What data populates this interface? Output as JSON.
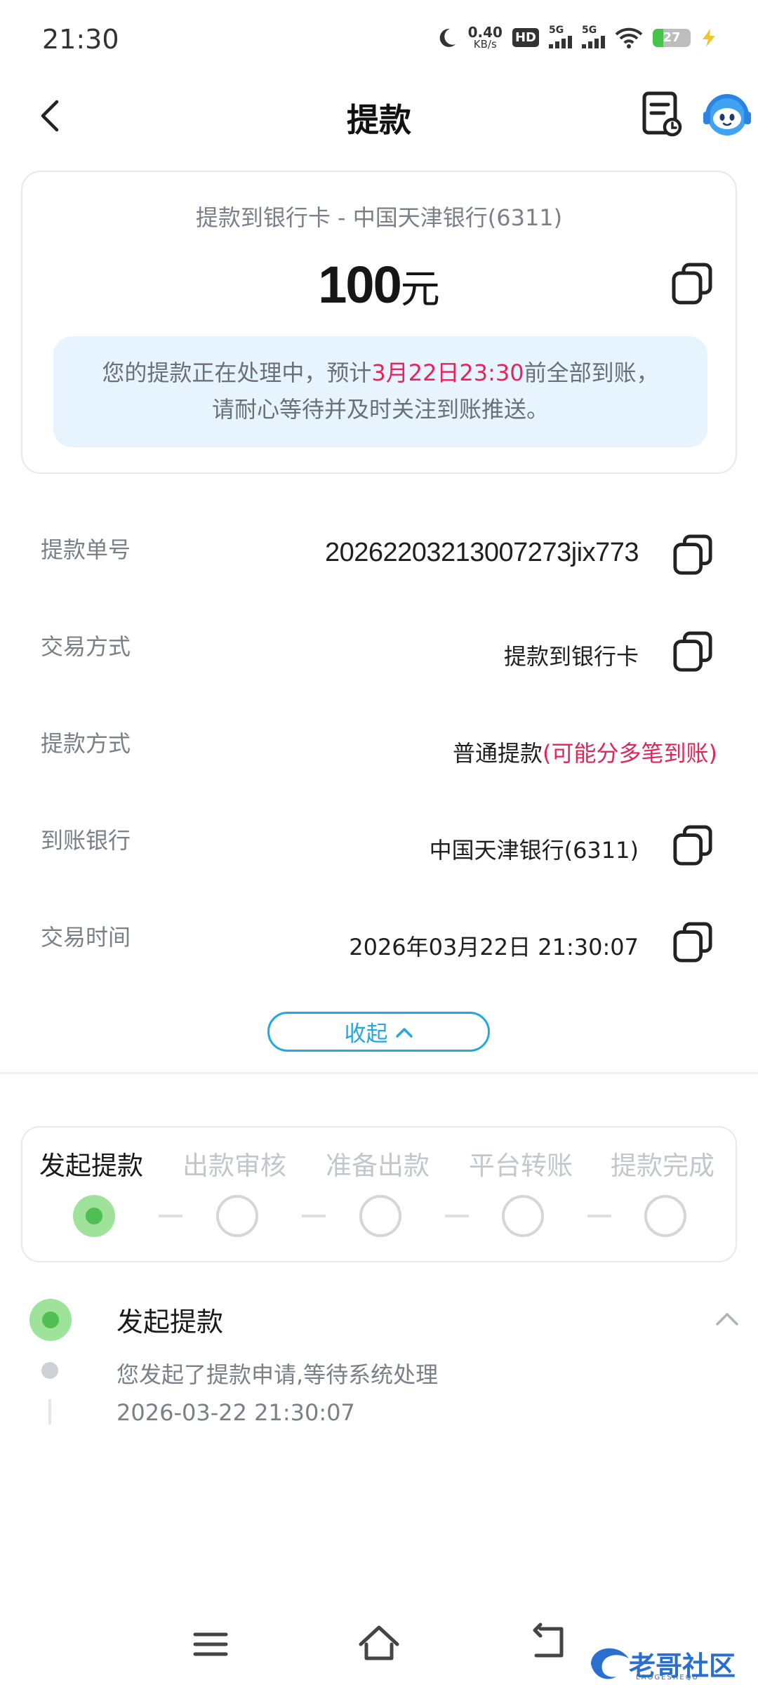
{
  "status_bar": {
    "time": "21:30",
    "net_speed_value": "0.40",
    "net_speed_unit": "KB/s",
    "hd_label": "HD",
    "signal1_label": "5G",
    "signal2_label": "5G",
    "battery_level": "27"
  },
  "header": {
    "title": "提款"
  },
  "summary": {
    "destination": "提款到银行卡 - 中国天津银行(6311)",
    "amount_number": "100",
    "amount_unit": "元",
    "notice_prefix": "您的提款正在处理中，预计",
    "notice_highlight": "3月22日23:30",
    "notice_suffix": "前全部到账，",
    "notice_line2": "请耐心等待并及时关注到账推送。"
  },
  "details": {
    "order_no_label": "提款单号",
    "order_no_value": "20262203213007273jix773",
    "trade_method_label": "交易方式",
    "trade_method_value": "提款到银行卡",
    "withdraw_method_label": "提款方式",
    "withdraw_method_value": "普通提款",
    "withdraw_method_note": "(可能分多笔到账)",
    "bank_label": "到账银行",
    "bank_value": "中国天津银行(6311)",
    "time_label": "交易时间",
    "time_value": "2026年03月22日 21:30:07"
  },
  "collapse_label": "收起",
  "progress": {
    "steps": [
      "发起提款",
      "出款审核",
      "准备出款",
      "平台转账",
      "提款完成"
    ],
    "current_step": 1
  },
  "timeline": {
    "title": "发起提款",
    "description": "您发起了提款申请,等待系统处理",
    "time": "2026-03-22 21:30:07"
  },
  "watermark": {
    "text": "老哥社区",
    "sub": "LAOGESHEQU"
  },
  "colors": {
    "accent_blue": "#24a6e0",
    "highlight_red": "#e5245a",
    "success_green": "#4fbf54"
  }
}
